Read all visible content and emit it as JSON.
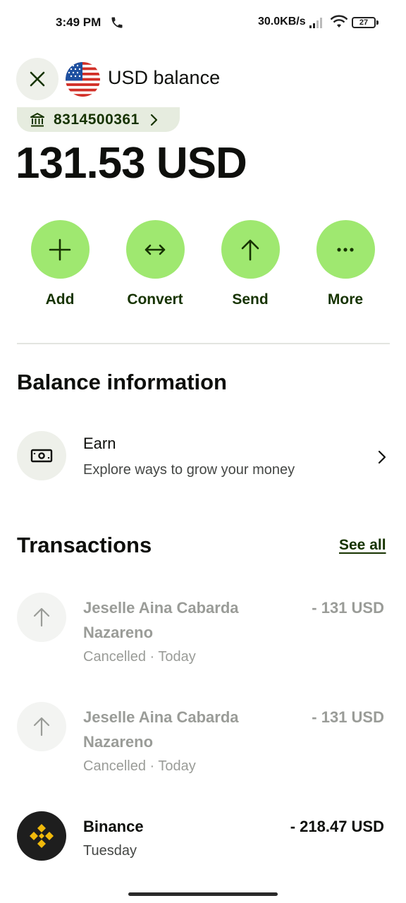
{
  "status_bar": {
    "time": "3:49 PM",
    "net_speed": "30.0KB/s",
    "battery": "27",
    "icons": [
      "phone-call-icon",
      "signal-icon",
      "wifi-icon",
      "battery-icon"
    ]
  },
  "header": {
    "title": "USD balance",
    "close_icon": "close-icon",
    "flag_icon": "us-flag-icon"
  },
  "account": {
    "number": "8314500361",
    "icon": "bank-icon"
  },
  "balance": "131.53 USD",
  "actions": [
    {
      "label": "Add",
      "icon": "plus-icon"
    },
    {
      "label": "Convert",
      "icon": "convert-arrows-icon"
    },
    {
      "label": "Send",
      "icon": "arrow-up-icon"
    },
    {
      "label": "More",
      "icon": "more-dots-icon"
    }
  ],
  "balance_info": {
    "title": "Balance information",
    "earn": {
      "title": "Earn",
      "subtitle": "Explore ways to grow your money",
      "icon": "banknote-icon"
    }
  },
  "transactions": {
    "title": "Transactions",
    "see_all": "See all",
    "items": [
      {
        "name": "Jeselle Aina Cabarda Nazareno",
        "amount": "- 131 USD",
        "meta": "Cancelled · Today",
        "status": "cancelled",
        "icon": "arrow-up-icon"
      },
      {
        "name": "Jeselle Aina Cabarda Nazareno",
        "amount": "- 131 USD",
        "meta": "Cancelled · Today",
        "status": "cancelled",
        "icon": "arrow-up-icon"
      },
      {
        "name": "Binance",
        "amount": "- 218.47 USD",
        "meta": "Tuesday",
        "status": "completed",
        "icon": "binance-logo-icon"
      }
    ]
  },
  "colors": {
    "accent_green": "#9fe870",
    "forest_green": "#163300",
    "chip_bg": "#e6ecdf",
    "muted_text": "#9a9c98",
    "binance_yellow": "#f0b90b"
  }
}
